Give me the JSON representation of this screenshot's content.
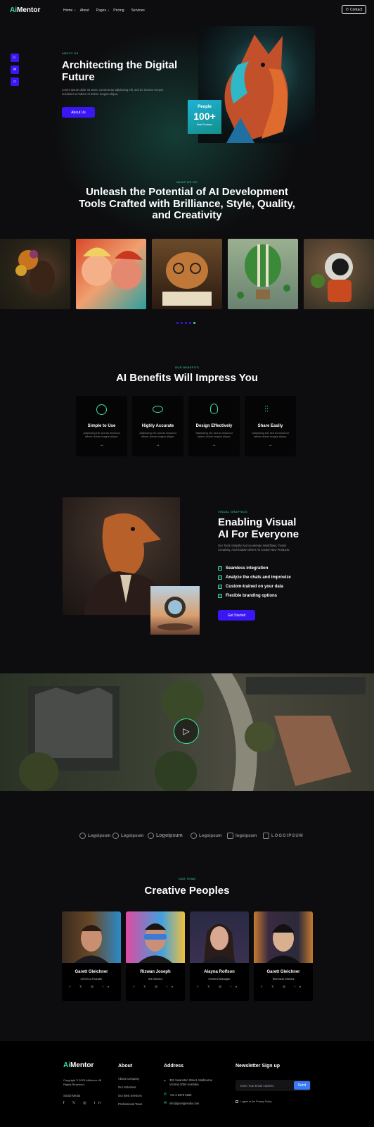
{
  "header": {
    "logo_ai": "Ai",
    "logo_rest": "Mentor",
    "nav": [
      "Home",
      "About",
      "Pages",
      "Pricing",
      "Services"
    ],
    "contact": "Contact"
  },
  "hero": {
    "eyebrow": "ABOUT US",
    "title": "Architecting the Digital Future",
    "text": "Lorem ipsum dolor sit amet, consectetur adipiscing elit, sed do eiusmo tempor incididunt ut labore et dolore magna aliqua.",
    "button": "About Us",
    "badge_label": "People",
    "badge_value": "100+",
    "badge_sub": "Best Reviews"
  },
  "whatwedo": {
    "eyebrow": "WHAT WE DO",
    "title": "Unleash the Potential of AI Development Tools Crafted with Brilliance, Style, Quality, and Creativity"
  },
  "benefits": {
    "eyebrow": "OUR BENEFITS",
    "title": "AI Benefits Will Impress You",
    "items": [
      {
        "title": "Simple to Use",
        "text": "Adipiscing elit, sed do eiusmod labore dolore magna aliqua."
      },
      {
        "title": "Highly Accurate",
        "text": "Adipiscing elit, sed do eiusmod labore dolore magna aliqua."
      },
      {
        "title": "Design Effectively",
        "text": "Adipiscing elit, sed do eiusmod labore dolore magna aliqua."
      },
      {
        "title": "Share Easily",
        "text": "Adipiscing elit, sed do eiusmod labore dolore magna aliqua."
      }
    ]
  },
  "visual": {
    "eyebrow": "VISUAL GRAPHICS",
    "title": "Enabling Visual AI For Everyone",
    "text": "Our Tools Simplify And Accelerate Workflows, Foster Creativity, And Enable Others To Create New Products.",
    "checks": [
      "Seamless integration",
      "Analyze the chats and improvize",
      "Custom-trained on your data",
      "Flexible branding options"
    ],
    "button": "Get Started"
  },
  "partners": [
    "Logoipsum",
    "Logoipsum",
    "Logoipsum",
    "Logoipsum",
    "logoipsum",
    "LOGOIPSUM"
  ],
  "team": {
    "eyebrow": "OUR TEAM",
    "title": "Creative Peoples",
    "members": [
      {
        "name": "Garett Gleichner",
        "role": "CEO/Co-Founder"
      },
      {
        "name": "Rizwan Joseph",
        "role": "Art Director"
      },
      {
        "name": "Alayna Rolfson",
        "role": "General Manager"
      },
      {
        "name": "Garett Gleichner",
        "role": "Technical Director"
      }
    ]
  },
  "footer": {
    "logo_ai": "Ai",
    "logo_rest": "Mentor",
    "copyright": "Copyright © 2023 AiMentor. All Rights Reserved.",
    "social_label": "Social Media",
    "about_title": "About",
    "about_links": [
      "About Company",
      "Our Solutions",
      "Our Best Services",
      "Professional Team"
    ],
    "address_title": "Address",
    "address": "301 Swanston Street, Melbourne Victoria 3053 Australia",
    "phone": "+61 3 8376 6284",
    "email": "info@pixelgmedia.com",
    "newsletter_title": "Newsletter Sign up",
    "email_placeholder": "Enter Your Email Address",
    "send": "Send",
    "agree": "I agree to the Privacy Policy"
  }
}
